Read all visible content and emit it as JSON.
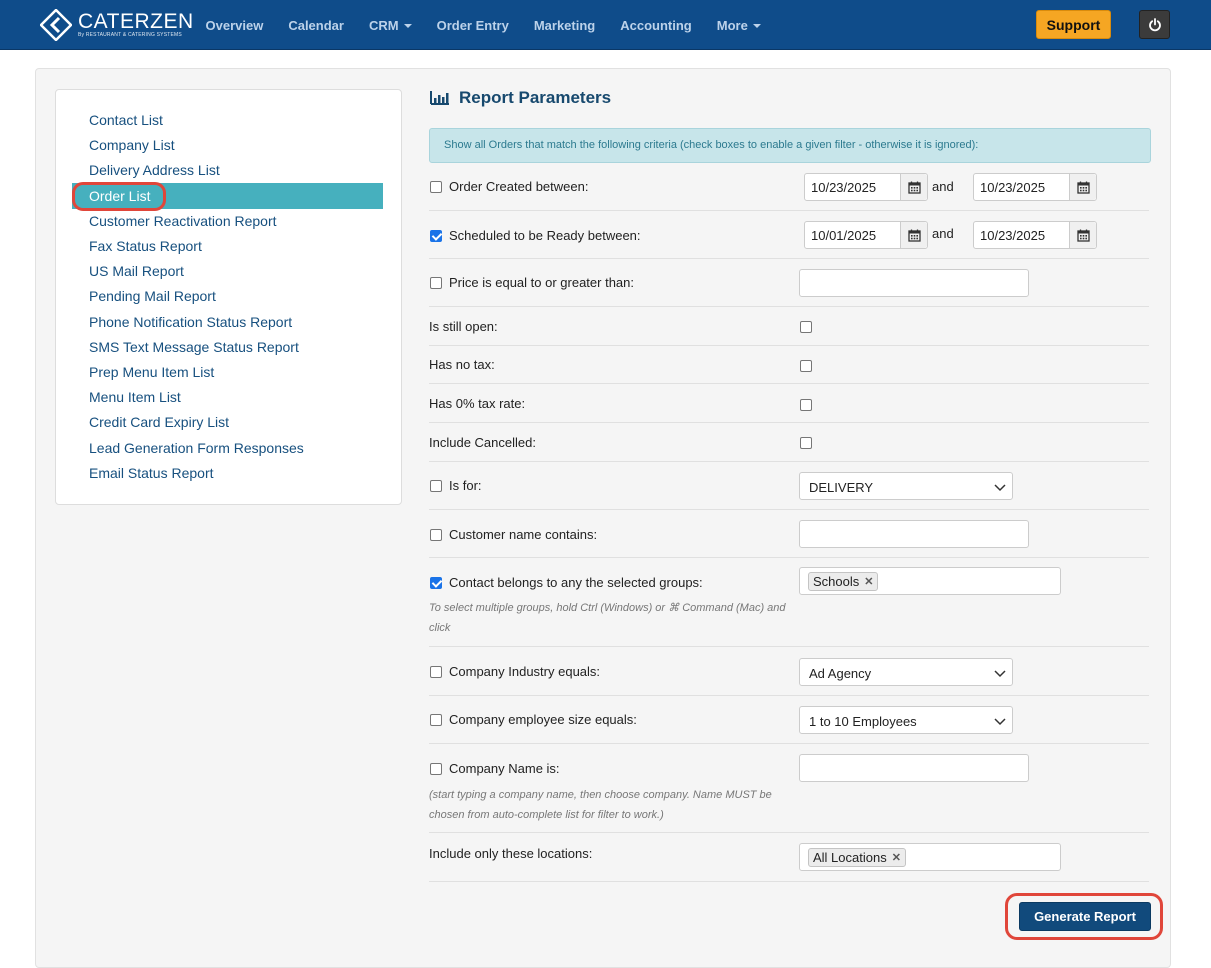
{
  "app": {
    "logo_name": "CATERZEN",
    "logo_sub": "By RESTAURANT & CATERING SYSTEMS"
  },
  "nav": {
    "items": [
      {
        "label": "Overview",
        "dropdown": false
      },
      {
        "label": "Calendar",
        "dropdown": false
      },
      {
        "label": "CRM",
        "dropdown": true
      },
      {
        "label": "Order Entry",
        "dropdown": false
      },
      {
        "label": "Marketing",
        "dropdown": false
      },
      {
        "label": "Accounting",
        "dropdown": false
      },
      {
        "label": "More",
        "dropdown": true
      }
    ],
    "support_label": "Support",
    "power_icon": "power-icon"
  },
  "sidebar": {
    "items": [
      "Contact List",
      "Company List",
      "Delivery Address List",
      "Order List",
      "Customer Reactivation Report",
      "Fax Status Report",
      "US Mail Report",
      "Pending Mail Report",
      "Phone Notification Status Report",
      "SMS Text Message Status Report",
      "Prep Menu Item List",
      "Menu Item List",
      "Credit Card Expiry List",
      "Lead Generation Form Responses",
      "Email Status Report"
    ],
    "active": "Order List"
  },
  "main": {
    "title": "Report Parameters",
    "title_icon": "bar-chart-icon",
    "info": "Show all Orders that match the following criteria (check boxes to enable a given filter - otherwise it is ignored):",
    "and_label": "and",
    "filters": {
      "order_created": {
        "label": "Order Created between:",
        "checked": false,
        "from": "10/23/2025",
        "to": "10/23/2025"
      },
      "scheduled_ready": {
        "label": "Scheduled to be Ready between:",
        "checked": true,
        "from": "10/01/2025",
        "to": "10/23/2025"
      },
      "price": {
        "label": "Price is equal to or greater than:",
        "checked": false,
        "value": ""
      },
      "still_open": {
        "label": "Is still open:",
        "checked": false
      },
      "no_tax": {
        "label": "Has no tax:",
        "checked": false
      },
      "zero_tax": {
        "label": "Has 0% tax rate:",
        "checked": false
      },
      "include_cancelled": {
        "label": "Include Cancelled:",
        "checked": false
      },
      "is_for": {
        "label": "Is for:",
        "checked": false,
        "value": "DELIVERY"
      },
      "customer_name": {
        "label": "Customer name contains:",
        "checked": false,
        "value": ""
      },
      "contact_groups": {
        "label": "Contact belongs to any the selected groups:",
        "checked": true,
        "tag": "Schools",
        "hint": "To select multiple groups, hold Ctrl (Windows) or ⌘ Command (Mac) and click"
      },
      "industry": {
        "label": "Company Industry equals:",
        "checked": false,
        "value": "Ad Agency"
      },
      "employee_size": {
        "label": "Company employee size equals:",
        "checked": false,
        "value": "1 to 10 Employees"
      },
      "company_name": {
        "label": "Company Name is:",
        "checked": false,
        "value": "",
        "hint": "(start typing a company name, then choose company. Name MUST be chosen from auto-complete list for filter to work.)"
      },
      "locations": {
        "label": "Include only these locations:",
        "tag": "All Locations"
      }
    },
    "generate_label": "Generate Report"
  },
  "colors": {
    "navbar": "#0f4c8a",
    "support": "#f5a623",
    "active_item": "#46b0be",
    "generate": "#114a7c",
    "highlight": "#e0463a"
  }
}
